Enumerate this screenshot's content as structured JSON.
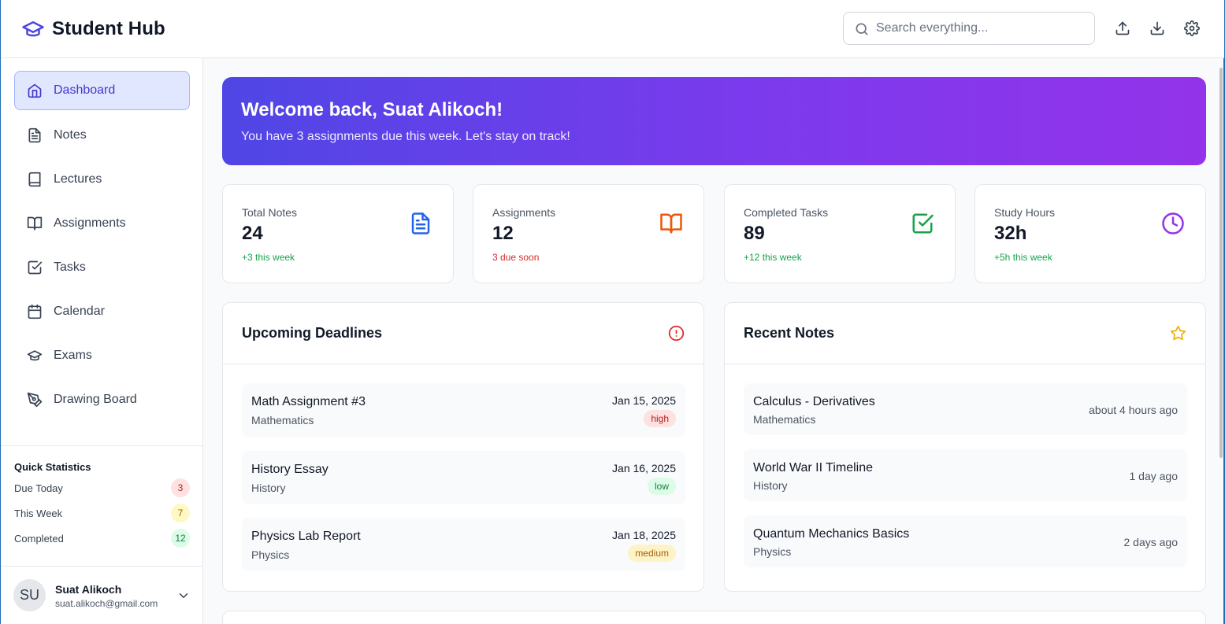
{
  "app": {
    "title": "Student Hub"
  },
  "header": {
    "search_placeholder": "Search everything...",
    "upload_icon": "upload-icon",
    "download_icon": "download-icon",
    "settings_icon": "gear-icon"
  },
  "sidebar": {
    "items": [
      {
        "label": "Dashboard",
        "icon": "home-icon",
        "active": true
      },
      {
        "label": "Notes",
        "icon": "file-text-icon"
      },
      {
        "label": "Lectures",
        "icon": "book-icon"
      },
      {
        "label": "Assignments",
        "icon": "book-open-icon"
      },
      {
        "label": "Tasks",
        "icon": "check-square-icon"
      },
      {
        "label": "Calendar",
        "icon": "calendar-icon"
      },
      {
        "label": "Exams",
        "icon": "graduation-cap-icon"
      },
      {
        "label": "Drawing Board",
        "icon": "pen-tool-icon"
      }
    ],
    "quick_stats": {
      "title": "Quick Statistics",
      "rows": [
        {
          "label": "Due Today",
          "value": "3",
          "color": "#fee2e2",
          "text_color": "#b91c1c"
        },
        {
          "label": "This Week",
          "value": "7",
          "color": "#fef9c3",
          "text_color": "#a16207"
        },
        {
          "label": "Completed",
          "value": "12",
          "color": "#dcfce7",
          "text_color": "#15803d"
        }
      ]
    },
    "user": {
      "initials": "SU",
      "name": "Suat Alikoch",
      "email": "suat.alikoch@gmail.com"
    }
  },
  "banner": {
    "title": "Welcome back, Suat Alikoch!",
    "subtitle": "You have 3 assignments due this week. Let's stay on track!"
  },
  "stats": [
    {
      "label": "Total Notes",
      "value": "24",
      "delta": "+3 this week",
      "delta_color": "#16a34a",
      "icon": "file-text-icon",
      "icon_color": "#2563eb"
    },
    {
      "label": "Assignments",
      "value": "12",
      "delta": "3 due soon",
      "delta_color": "#dc2626",
      "icon": "book-open-icon",
      "icon_color": "#ea580c"
    },
    {
      "label": "Completed Tasks",
      "value": "89",
      "delta": "+12 this week",
      "delta_color": "#16a34a",
      "icon": "check-square-icon",
      "icon_color": "#16a34a"
    },
    {
      "label": "Study Hours",
      "value": "32h",
      "delta": "+5h this week",
      "delta_color": "#16a34a",
      "icon": "clock-icon",
      "icon_color": "#9333ea"
    }
  ],
  "deadlines": {
    "title": "Upcoming Deadlines",
    "icon": "alert-circle-icon",
    "items": [
      {
        "title": "Math Assignment #3",
        "subject": "Mathematics",
        "date": "Jan 15, 2025",
        "priority": "high"
      },
      {
        "title": "History Essay",
        "subject": "History",
        "date": "Jan 16, 2025",
        "priority": "low"
      },
      {
        "title": "Physics Lab Report",
        "subject": "Physics",
        "date": "Jan 18, 2025",
        "priority": "medium"
      }
    ]
  },
  "recent_notes": {
    "title": "Recent Notes",
    "icon": "star-icon",
    "items": [
      {
        "title": "Calculus - Derivatives",
        "subject": "Mathematics",
        "time": "about 4 hours ago"
      },
      {
        "title": "World War II Timeline",
        "subject": "History",
        "time": "1 day ago"
      },
      {
        "title": "Quantum Mechanics Basics",
        "subject": "Physics",
        "time": "2 days ago"
      }
    ]
  },
  "colors": {
    "accent": "#4f46e5",
    "gradient_start": "#4f46e5",
    "gradient_end": "#9333ea",
    "priority_high": "#fee2e2",
    "priority_low": "#dcfce7",
    "priority_medium": "#fef3c7"
  }
}
